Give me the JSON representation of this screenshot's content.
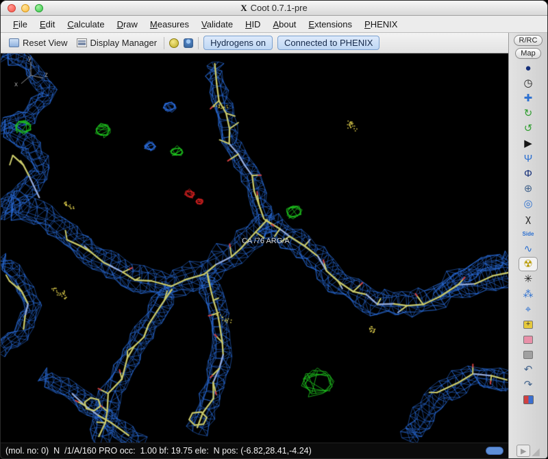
{
  "window": {
    "title": "Coot 0.7.1-pre",
    "x11_icon": "X"
  },
  "menu": {
    "items": [
      "File",
      "Edit",
      "Calculate",
      "Draw",
      "Measures",
      "Validate",
      "HID",
      "About",
      "Extensions",
      "PHENIX"
    ]
  },
  "toolbar": {
    "reset_view_label": "Reset View",
    "display_manager_label": "Display Manager",
    "hydrogens_toggle_label": "Hydrogens on",
    "phenix_toggle_label": "Connected to PHENIX"
  },
  "right_rail": {
    "r_rc_label": "R/RC",
    "map_label": "Map",
    "icons": [
      {
        "name": "sphere-icon",
        "glyph": "●",
        "color": "#16307a"
      },
      {
        "name": "clock-icon",
        "glyph": "◷",
        "color": "#222222"
      },
      {
        "name": "move-atoms-icon",
        "glyph": "✚",
        "color": "#2b6fd0"
      },
      {
        "name": "rotate-zone-icon",
        "glyph": "↻",
        "color": "#2f9e2f"
      },
      {
        "name": "torsion-icon",
        "glyph": "↺",
        "color": "#2f9e2f"
      },
      {
        "name": "play-icon",
        "glyph": "▶",
        "color": "#151515"
      },
      {
        "name": "rotamer-icon",
        "glyph": "Ψ",
        "color": "#2b6fd0"
      },
      {
        "name": "mutate-icon",
        "glyph": "Φ",
        "color": "#16307a"
      },
      {
        "name": "add-terminal-residue-icon",
        "glyph": "⊕",
        "color": "#44648c"
      },
      {
        "name": "sphere-refine-icon",
        "glyph": "◎",
        "color": "#2b6fd0"
      },
      {
        "name": "chi-angles-icon",
        "glyph": "χ",
        "color": "#222222"
      },
      {
        "name": "side-chain-icon",
        "glyph": "Side",
        "color": "#2b6fd0"
      },
      {
        "name": "jiggle-fit-icon",
        "glyph": "∿",
        "color": "#2b6fd0"
      },
      {
        "name": "radiation-icon",
        "glyph": "☢",
        "color": "#b89a00"
      },
      {
        "name": "kill-sidechain-icon",
        "glyph": "✳",
        "color": "#1a1a1a"
      },
      {
        "name": "add-waters-icon",
        "glyph": "⁂",
        "color": "#2b6fd0"
      },
      {
        "name": "find-ligand-icon",
        "glyph": "⌖",
        "color": "#2b6fd0"
      },
      {
        "name": "add-residue-icon",
        "glyph": "+",
        "color": "#e6c93c"
      },
      {
        "name": "eraser-icon",
        "glyph": "",
        "color": "#e890a8"
      },
      {
        "name": "delete-item-icon",
        "glyph": "",
        "color": "#a0a0a0"
      },
      {
        "name": "undo-icon",
        "glyph": "↶",
        "color": "#44648c"
      },
      {
        "name": "redo-icon",
        "glyph": "↷",
        "color": "#44648c"
      },
      {
        "name": "display-flag-icon",
        "glyph": "",
        "color": "#d04040"
      }
    ]
  },
  "viewport": {
    "residue_label": "CA /76 ARG/A",
    "axis_labels": {
      "x": "x",
      "y": "y",
      "z": "z"
    },
    "colors": {
      "background": "#000000",
      "density_mesh": "#2b6fe0",
      "model_carbon": "#c9c96a",
      "model_nitrogen": "#93aadc",
      "model_oxygen": "#d04040",
      "positive_difference": "#1ec41e",
      "negative_difference": "#d02020",
      "dots": "#d8c84a"
    }
  },
  "statusbar": {
    "text": "(mol. no: 0)  N  /1/A/160 PRO occ:  1.00 bf: 19.75 ele:  N pos: (-6.82,28.41,-4.24)"
  }
}
